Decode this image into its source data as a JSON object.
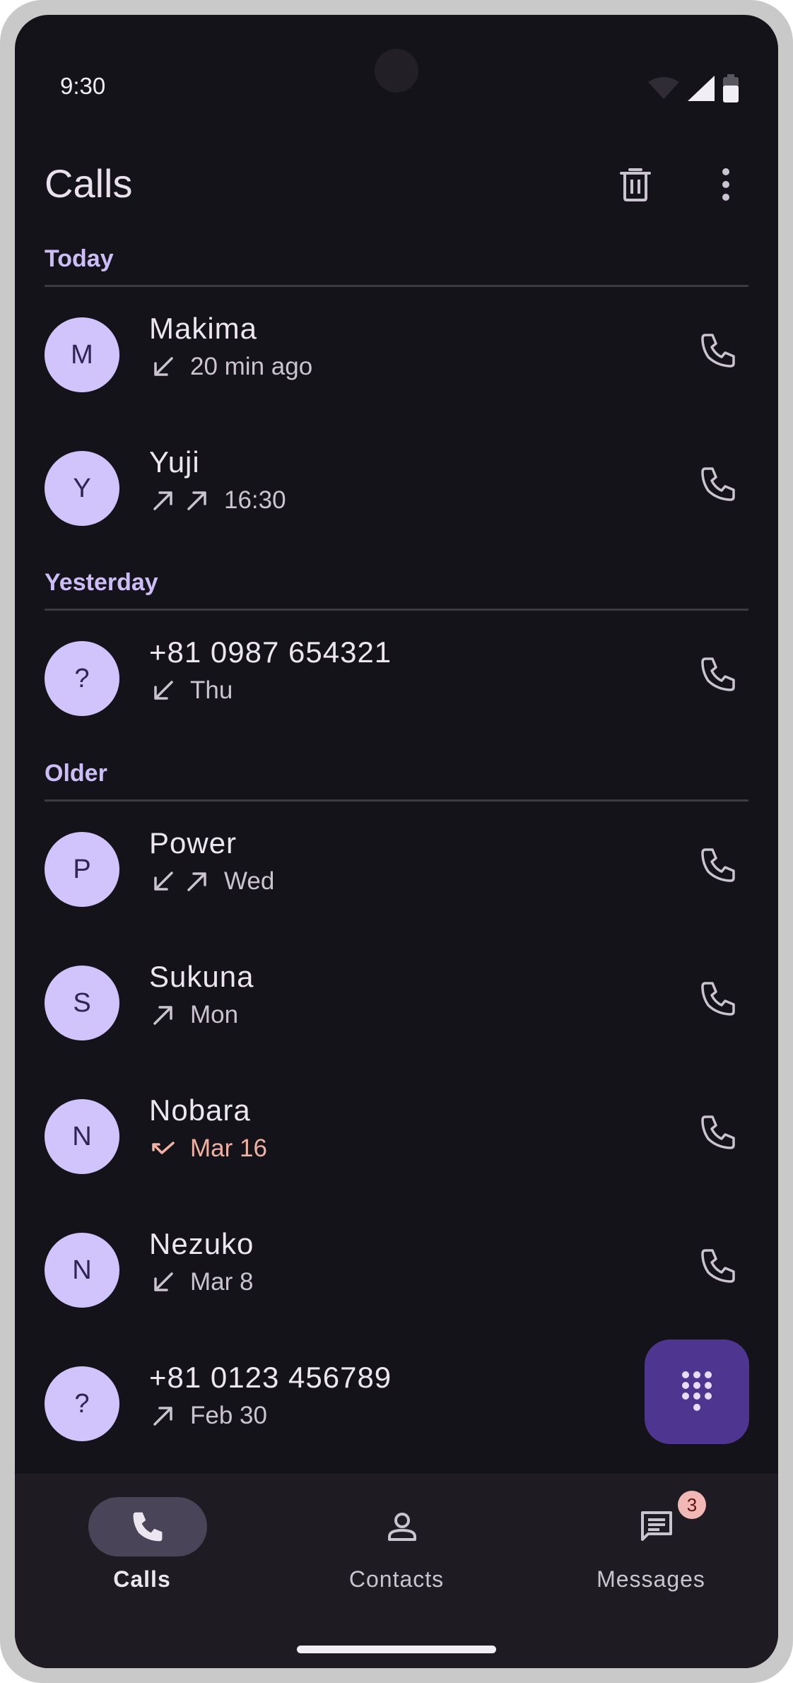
{
  "status": {
    "time": "9:30"
  },
  "appbar": {
    "title": "Calls"
  },
  "sections": [
    {
      "title": "Today"
    },
    {
      "title": "Yesterday"
    },
    {
      "title": "Older"
    }
  ],
  "calls": [
    {
      "initial": "M",
      "name": "Makima",
      "time": "20 min ago",
      "types": [
        "incoming"
      ],
      "missed": false
    },
    {
      "initial": "Y",
      "name": "Yuji",
      "time": "16:30",
      "types": [
        "outgoing",
        "outgoing"
      ],
      "missed": false
    },
    {
      "initial": "?",
      "name": "+81 0987 654321",
      "time": "Thu",
      "types": [
        "incoming"
      ],
      "missed": false
    },
    {
      "initial": "P",
      "name": "Power",
      "time": "Wed",
      "types": [
        "incoming",
        "outgoing"
      ],
      "missed": false
    },
    {
      "initial": "S",
      "name": "Sukuna",
      "time": "Mon",
      "types": [
        "outgoing"
      ],
      "missed": false
    },
    {
      "initial": "N",
      "name": "Nobara",
      "time": "Mar 16",
      "types": [
        "missed"
      ],
      "missed": true
    },
    {
      "initial": "N",
      "name": "Nezuko",
      "time": "Mar 8",
      "types": [
        "incoming"
      ],
      "missed": false
    },
    {
      "initial": "?",
      "name": "+81 0123 456789",
      "time": "Feb 30",
      "types": [
        "outgoing"
      ],
      "missed": false
    }
  ],
  "nav": {
    "calls_label": "Calls",
    "contacts_label": "Contacts",
    "messages_label": "Messages",
    "messages_badge": "3"
  },
  "colors": {
    "background": "#15131a",
    "accent": "#cdbdf6",
    "avatar_bg": "#d1c3fb",
    "fab_bg": "#4e3590",
    "missed": "#f0b1a4"
  }
}
